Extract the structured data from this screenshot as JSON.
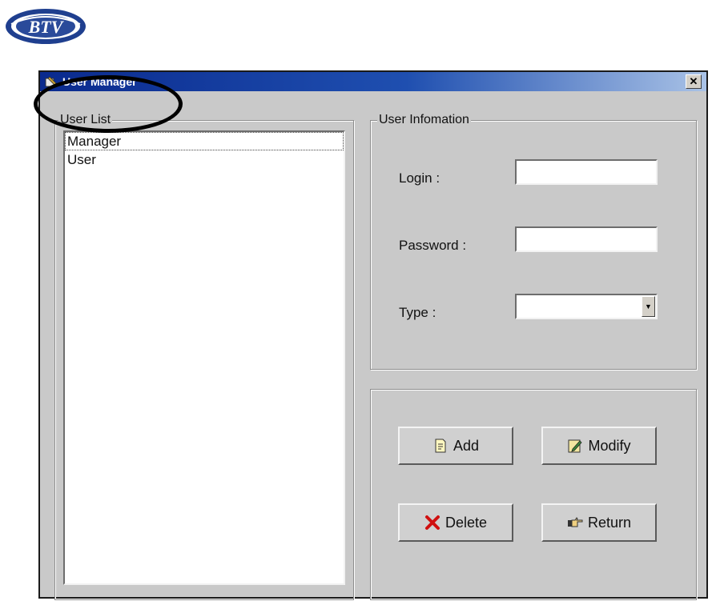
{
  "logo": {
    "text": "BTV",
    "icon": "globe-logo"
  },
  "window": {
    "title": "User Manager",
    "title_icon": "app-icon",
    "close_label": "✕"
  },
  "user_list": {
    "label": "User List",
    "items": [
      "Manager",
      "User"
    ],
    "selected_index": 0
  },
  "user_info": {
    "label": "User Infomation",
    "login_label": "Login :",
    "login_value": "",
    "password_label": "Password :",
    "password_value": "",
    "type_label": "Type :",
    "type_value": ""
  },
  "buttons": {
    "add": "Add",
    "modify": "Modify",
    "delete": "Delete",
    "return": "Return"
  },
  "colors": {
    "titlebar_start": "#0a2a8e",
    "titlebar_end": "#a9c2e6",
    "client_bg": "#c9c9c9",
    "logo_blue": "#1f3f8f",
    "delete_red": "#d01010"
  }
}
